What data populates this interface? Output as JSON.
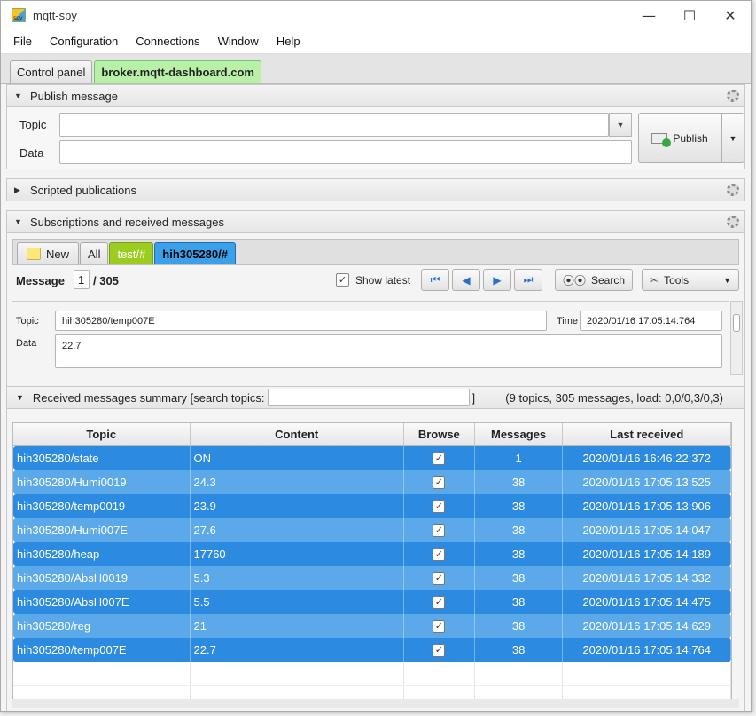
{
  "window": {
    "title": "mqtt-spy",
    "controls": {
      "minimize": "—",
      "maximize": "☐",
      "close": "✕"
    }
  },
  "menu": [
    "File",
    "Configuration",
    "Connections",
    "Window",
    "Help"
  ],
  "top_tabs": [
    "Control panel",
    "broker.mqtt-dashboard.com"
  ],
  "publish": {
    "header": "Publish message",
    "topic_label": "Topic",
    "data_label": "Data",
    "topic_value": "",
    "data_value": "",
    "publish_button": "Publish"
  },
  "scripted": {
    "header": "Scripted publications"
  },
  "subscriptions": {
    "header": "Subscriptions and received messages",
    "tabs": {
      "new": "New",
      "all": "All",
      "test": "test/#",
      "hih": "hih305280/#"
    },
    "message_label": "Message",
    "message_index": "1",
    "message_total": "/ 305",
    "show_latest": "Show latest",
    "search_button": "Search",
    "tools_button": "Tools",
    "detail": {
      "topic_label": "Topic",
      "topic_value": "hih305280/temp007E",
      "time_label": "Time",
      "time_value": "2020/01/16 17:05:14:764",
      "data_label": "Data",
      "data_value": "22.7"
    }
  },
  "summary": {
    "header": "Received messages summary [search topics:",
    "header_end": "]",
    "search_value": "",
    "stats": "(9 topics, 305 messages, load: 0,0/0,3/0,3)",
    "columns": [
      "Topic",
      "Content",
      "Browse",
      "Messages",
      "Last received"
    ],
    "rows": [
      {
        "topic": "hih305280/state",
        "content": "ON",
        "messages": "1",
        "last": "2020/01/16 16:46:22:372"
      },
      {
        "topic": "hih305280/Humi0019",
        "content": "24.3",
        "messages": "38",
        "last": "2020/01/16 17:05:13:525"
      },
      {
        "topic": "hih305280/temp0019",
        "content": "23.9",
        "messages": "38",
        "last": "2020/01/16 17:05:13:906"
      },
      {
        "topic": "hih305280/Humi007E",
        "content": "27.6",
        "messages": "38",
        "last": "2020/01/16 17:05:14:047"
      },
      {
        "topic": "hih305280/heap",
        "content": "17760",
        "messages": "38",
        "last": "2020/01/16 17:05:14:189"
      },
      {
        "topic": "hih305280/AbsH0019",
        "content": "5.3",
        "messages": "38",
        "last": "2020/01/16 17:05:14:332"
      },
      {
        "topic": "hih305280/AbsH007E",
        "content": "5.5",
        "messages": "38",
        "last": "2020/01/16 17:05:14:475"
      },
      {
        "topic": "hih305280/reg",
        "content": "21",
        "messages": "38",
        "last": "2020/01/16 17:05:14:629"
      },
      {
        "topic": "hih305280/temp007E",
        "content": "22.7",
        "messages": "38",
        "last": "2020/01/16 17:05:14:764"
      }
    ]
  }
}
